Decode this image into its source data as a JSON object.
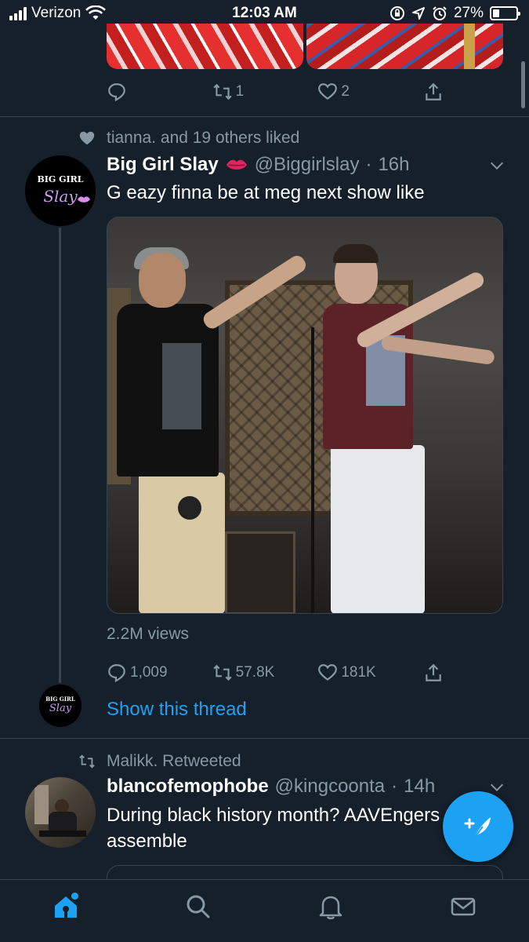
{
  "status_bar": {
    "carrier": "Verizon",
    "time": "12:03 AM",
    "battery": "27%",
    "icons": [
      "signal-icon",
      "wifi-icon",
      "screen-lock-icon",
      "location-icon",
      "alarm-icon",
      "battery-icon"
    ]
  },
  "prev_tweet": {
    "actions": {
      "reply_count": "",
      "retweet_count": "1",
      "like_count": "2"
    }
  },
  "tweet1": {
    "context": "tianna. and 19 others liked",
    "author_name": "Big Girl Slay",
    "handle": "@Biggirlslay",
    "separator": "·",
    "time": "16h",
    "text": "G eazy finna be at meg next show like",
    "avatar_top": "BIG GIRL",
    "avatar_script": "Slay",
    "views": "2.2M views",
    "actions": {
      "reply_count": "1,009",
      "retweet_count": "57.8K",
      "like_count": "181K"
    },
    "show_thread": "Show this thread"
  },
  "tweet2": {
    "context": "Malikk. Retweeted",
    "author_name": "blancofemophobe",
    "handle": "@kingcoonta",
    "separator": "·",
    "time": "14h",
    "text": "During black history month? AAVEngers assemble"
  },
  "colors": {
    "background": "#15202b",
    "accent": "#1da1f2",
    "muted": "#8899a6",
    "divider": "#38444d"
  },
  "tab_bar": {
    "tabs": [
      "home-icon",
      "search-icon",
      "notifications-icon",
      "messages-icon"
    ],
    "active": "home-icon"
  }
}
